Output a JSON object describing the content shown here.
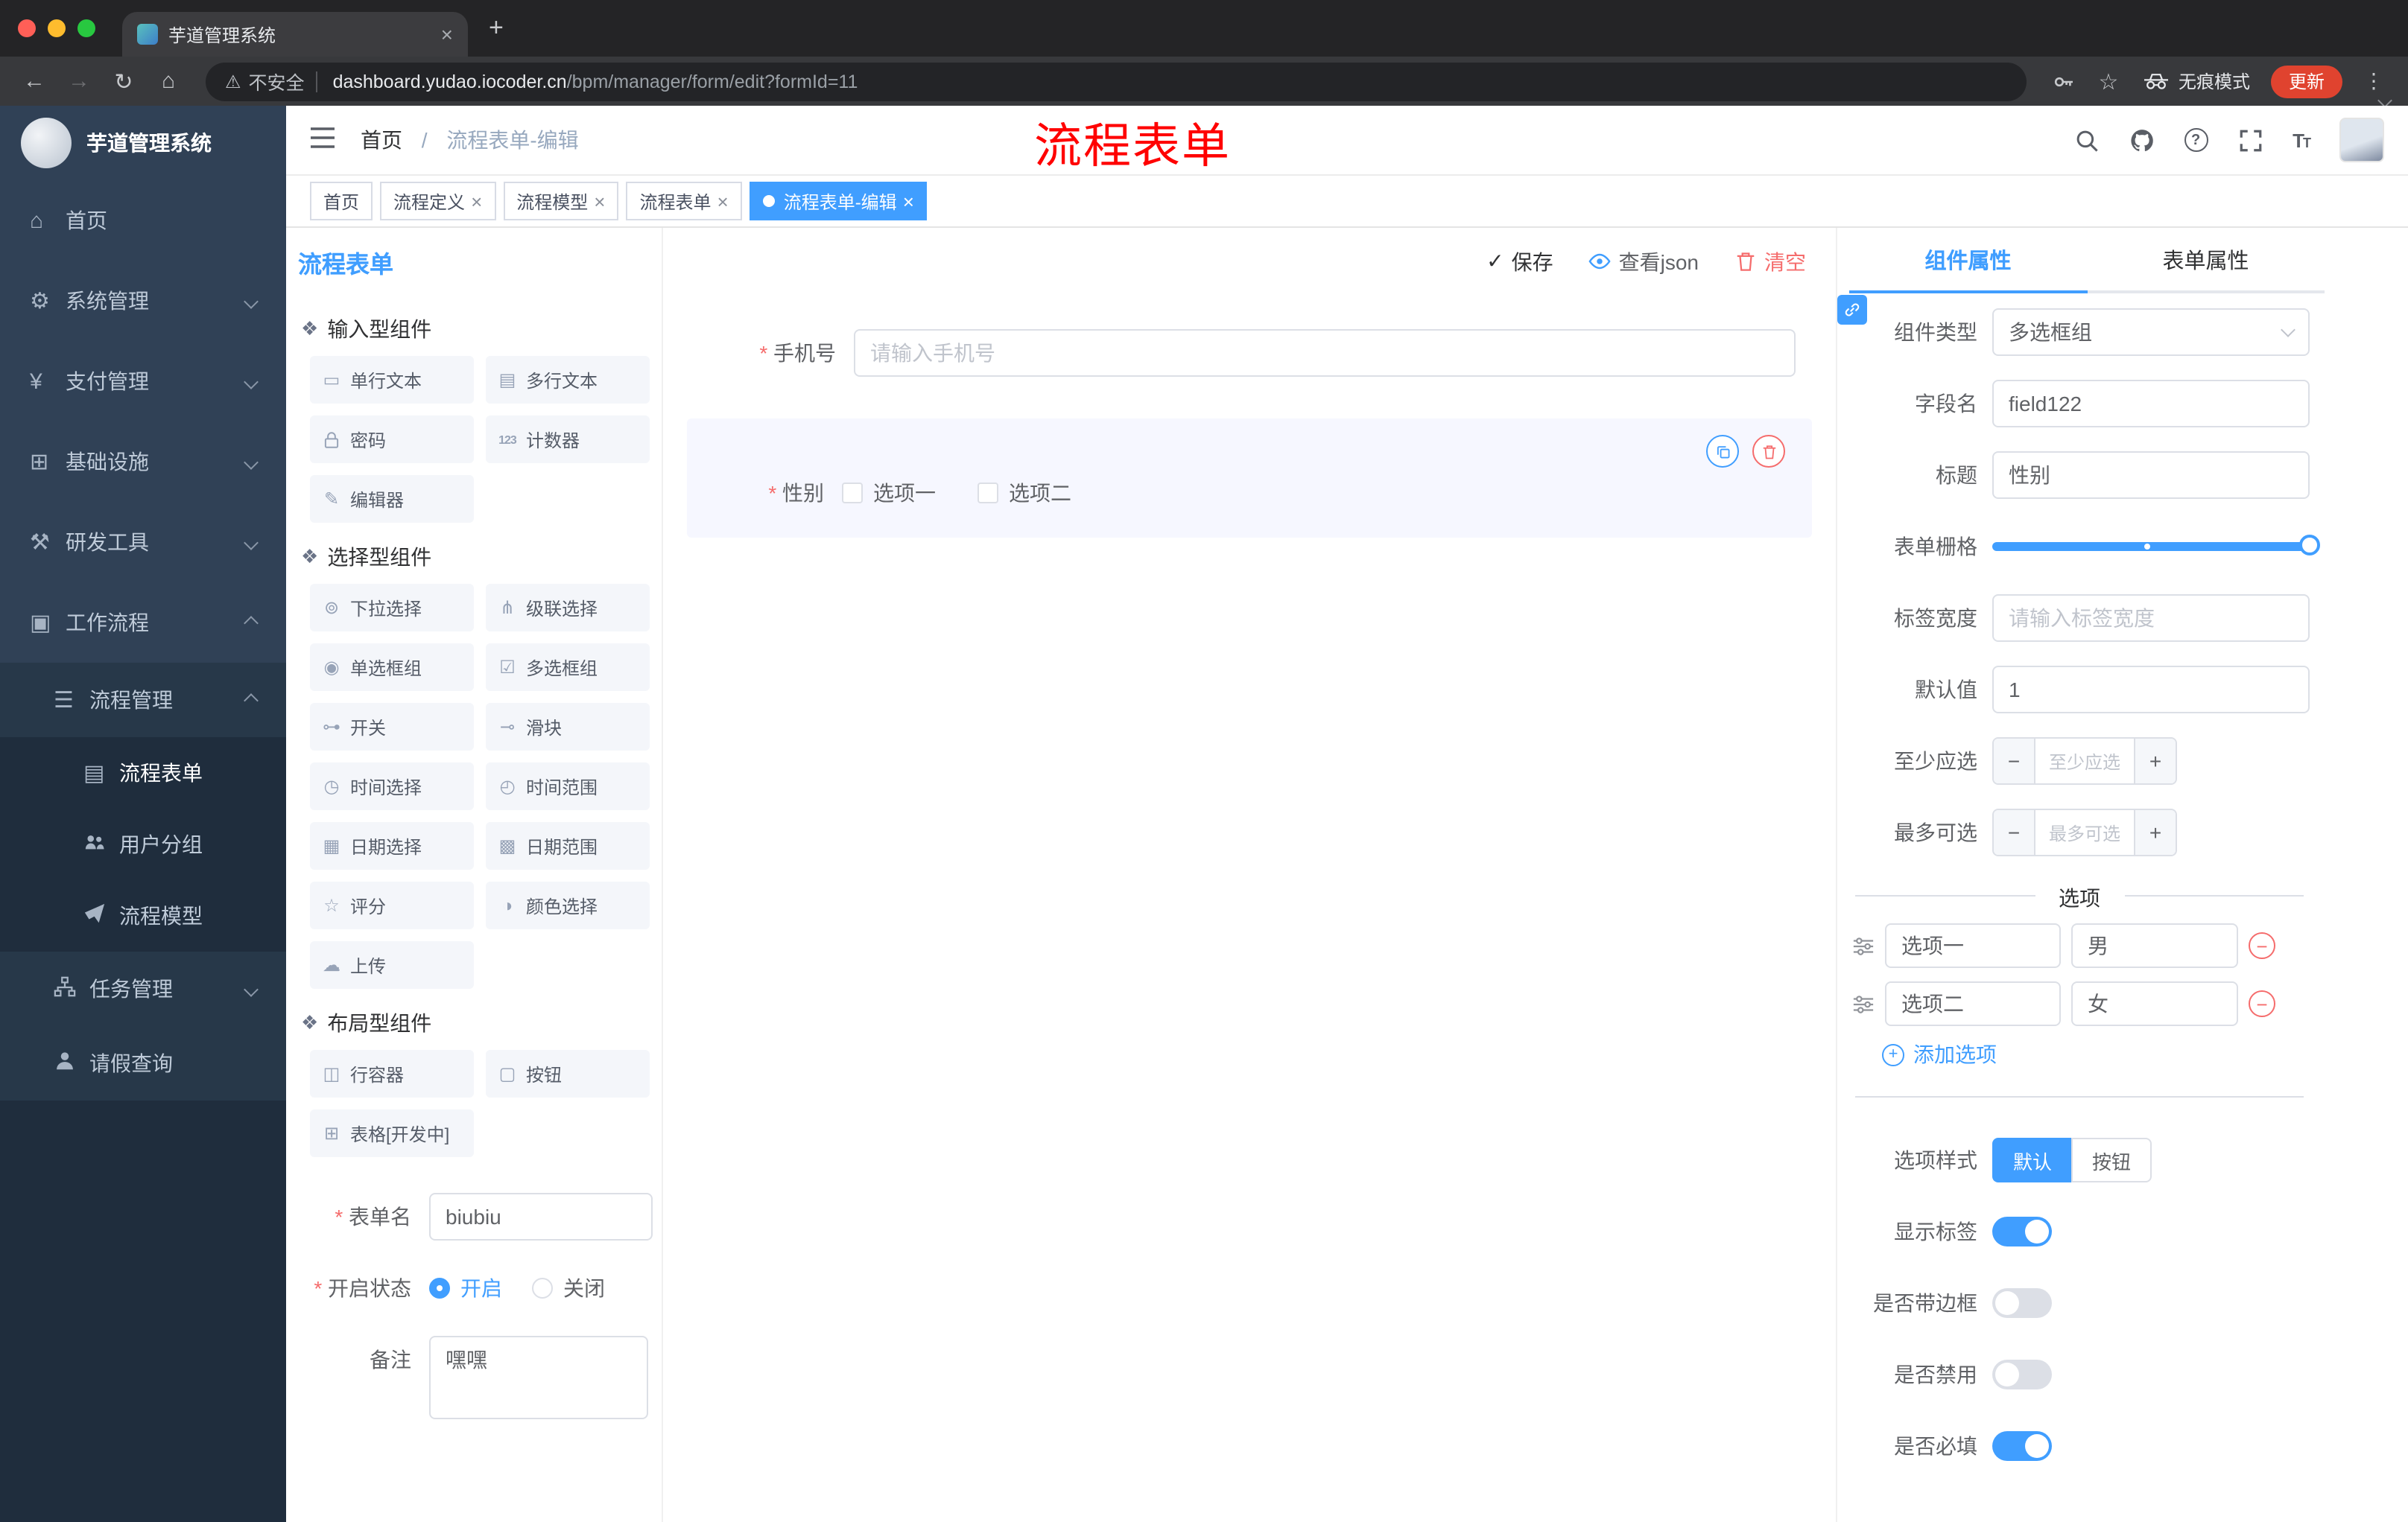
{
  "colors": {
    "primary": "#409EFF",
    "danger": "#F56C6C",
    "annotation_red": "#FF0000",
    "update_button": "#E0432F",
    "sidebar_bg": "#304156",
    "sidebar_submenu_bg": "#1F2D3D"
  },
  "browser": {
    "tab": {
      "title": "芋道管理系统"
    },
    "address_bar": {
      "security_label": "不安全",
      "url_host": "dashboard.yudao.iocoder.cn",
      "url_path": "/bpm/manager/form/edit?formId=11",
      "incognito_label": "无痕模式",
      "update_label": "更新"
    }
  },
  "sidebar": {
    "app_title": "芋道管理系统",
    "items": [
      {
        "label": "首页",
        "icon": "home-icon",
        "level": 1
      },
      {
        "label": "系统管理",
        "icon": "gear-icon",
        "level": 1,
        "chevron": "down"
      },
      {
        "label": "支付管理",
        "icon": "yen-icon",
        "level": 1,
        "chevron": "down"
      },
      {
        "label": "基础设施",
        "icon": "infrastructure-icon",
        "level": 1,
        "chevron": "down"
      },
      {
        "label": "研发工具",
        "icon": "tools-icon",
        "level": 1,
        "chevron": "down"
      },
      {
        "label": "工作流程",
        "icon": "workflow-icon",
        "level": 1,
        "chevron": "up"
      },
      {
        "label": "流程管理",
        "icon": "process-list-icon",
        "level": 2,
        "chevron": "up"
      },
      {
        "label": "流程表单",
        "icon": "form-doc-icon",
        "level": 3,
        "active": true
      },
      {
        "label": "用户分组",
        "icon": "user-group-icon",
        "level": 3
      },
      {
        "label": "流程模型",
        "icon": "paper-plane-icon",
        "level": 3
      },
      {
        "label": "任务管理",
        "icon": "task-tree-icon",
        "level": 2,
        "chevron": "down"
      },
      {
        "label": "请假查询",
        "icon": "person-icon",
        "level": 2
      }
    ]
  },
  "header": {
    "breadcrumb": {
      "home": "首页",
      "separator": "/",
      "current": "流程表单-编辑"
    },
    "annotation": "流程表单"
  },
  "tags": [
    {
      "label": "首页",
      "closable": false,
      "active": false
    },
    {
      "label": "流程定义",
      "closable": true,
      "active": false
    },
    {
      "label": "流程模型",
      "closable": true,
      "active": false
    },
    {
      "label": "流程表单",
      "closable": true,
      "active": false
    },
    {
      "label": "流程表单-编辑",
      "closable": true,
      "active": true
    }
  ],
  "designer": {
    "panel_title": "流程表单",
    "toolbar": {
      "save": "保存",
      "view_json": "查看json",
      "clear": "清空"
    },
    "palette": {
      "sections": [
        {
          "title": "输入型组件",
          "items": [
            {
              "label": "单行文本",
              "icon": "single-line-input-icon"
            },
            {
              "label": "多行文本",
              "icon": "textarea-icon"
            },
            {
              "label": "密码",
              "icon": "password-lock-icon"
            },
            {
              "label": "计数器",
              "icon": "counter-123-icon"
            },
            {
              "label": "编辑器",
              "icon": "rich-editor-icon"
            }
          ]
        },
        {
          "title": "选择型组件",
          "items": [
            {
              "label": "下拉选择",
              "icon": "select-dropdown-icon"
            },
            {
              "label": "级联选择",
              "icon": "cascader-icon"
            },
            {
              "label": "单选框组",
              "icon": "radio-group-icon"
            },
            {
              "label": "多选框组",
              "icon": "checkbox-group-icon"
            },
            {
              "label": "开关",
              "icon": "switch-icon"
            },
            {
              "label": "滑块",
              "icon": "slider-icon"
            },
            {
              "label": "时间选择",
              "icon": "time-picker-icon"
            },
            {
              "label": "时间范围",
              "icon": "time-range-icon"
            },
            {
              "label": "日期选择",
              "icon": "date-picker-icon"
            },
            {
              "label": "日期范围",
              "icon": "date-range-icon"
            },
            {
              "label": "评分",
              "icon": "rate-star-icon"
            },
            {
              "label": "颜色选择",
              "icon": "color-picker-icon"
            },
            {
              "label": "上传",
              "icon": "upload-cloud-icon"
            }
          ]
        },
        {
          "title": "布局型组件",
          "items": [
            {
              "label": "行容器",
              "icon": "row-container-icon"
            },
            {
              "label": "按钮",
              "icon": "button-icon"
            },
            {
              "label": "表格[开发中]",
              "icon": "table-icon"
            }
          ]
        }
      ]
    },
    "settings": {
      "form_name_label": "表单名",
      "form_name_value": "biubiu",
      "status_label": "开启状态",
      "status_options": [
        {
          "label": "开启",
          "selected": true
        },
        {
          "label": "关闭",
          "selected": false
        }
      ],
      "remark_label": "备注",
      "remark_value": "嘿嘿"
    },
    "canvas": {
      "fields": [
        {
          "label": "手机号",
          "required": true,
          "placeholder": "请输入手机号"
        },
        {
          "label": "性别",
          "required": true,
          "options": [
            "选项一",
            "选项二"
          ],
          "selected": true
        }
      ]
    }
  },
  "props": {
    "tabs": [
      {
        "label": "组件属性",
        "active": true
      },
      {
        "label": "表单属性",
        "active": false
      }
    ],
    "rows": {
      "component_type": {
        "label": "组件类型",
        "value": "多选框组"
      },
      "field_name": {
        "label": "字段名",
        "value": "field122"
      },
      "title": {
        "label": "标题",
        "value": "性别"
      },
      "grid": {
        "label": "表单栅格"
      },
      "label_width": {
        "label": "标签宽度",
        "placeholder": "请输入标签宽度"
      },
      "default_value": {
        "label": "默认值",
        "value": "1"
      },
      "min_select": {
        "label": "至少应选",
        "placeholder": "至少应选"
      },
      "max_select": {
        "label": "最多可选",
        "placeholder": "最多可选"
      }
    },
    "options_section": {
      "title": "选项",
      "rows": [
        {
          "label_value": "选项一",
          "value": "男"
        },
        {
          "label_value": "选项二",
          "value": "女"
        }
      ],
      "add_label": "添加选项"
    },
    "style_row": {
      "label": "选项样式",
      "options": [
        {
          "label": "默认",
          "active": true
        },
        {
          "label": "按钮",
          "active": false
        }
      ]
    },
    "toggles": [
      {
        "label": "显示标签",
        "state": "on"
      },
      {
        "label": "是否带边框",
        "state": "off"
      },
      {
        "label": "是否禁用",
        "state": "off"
      },
      {
        "label": "是否必填",
        "state": "on"
      }
    ]
  }
}
